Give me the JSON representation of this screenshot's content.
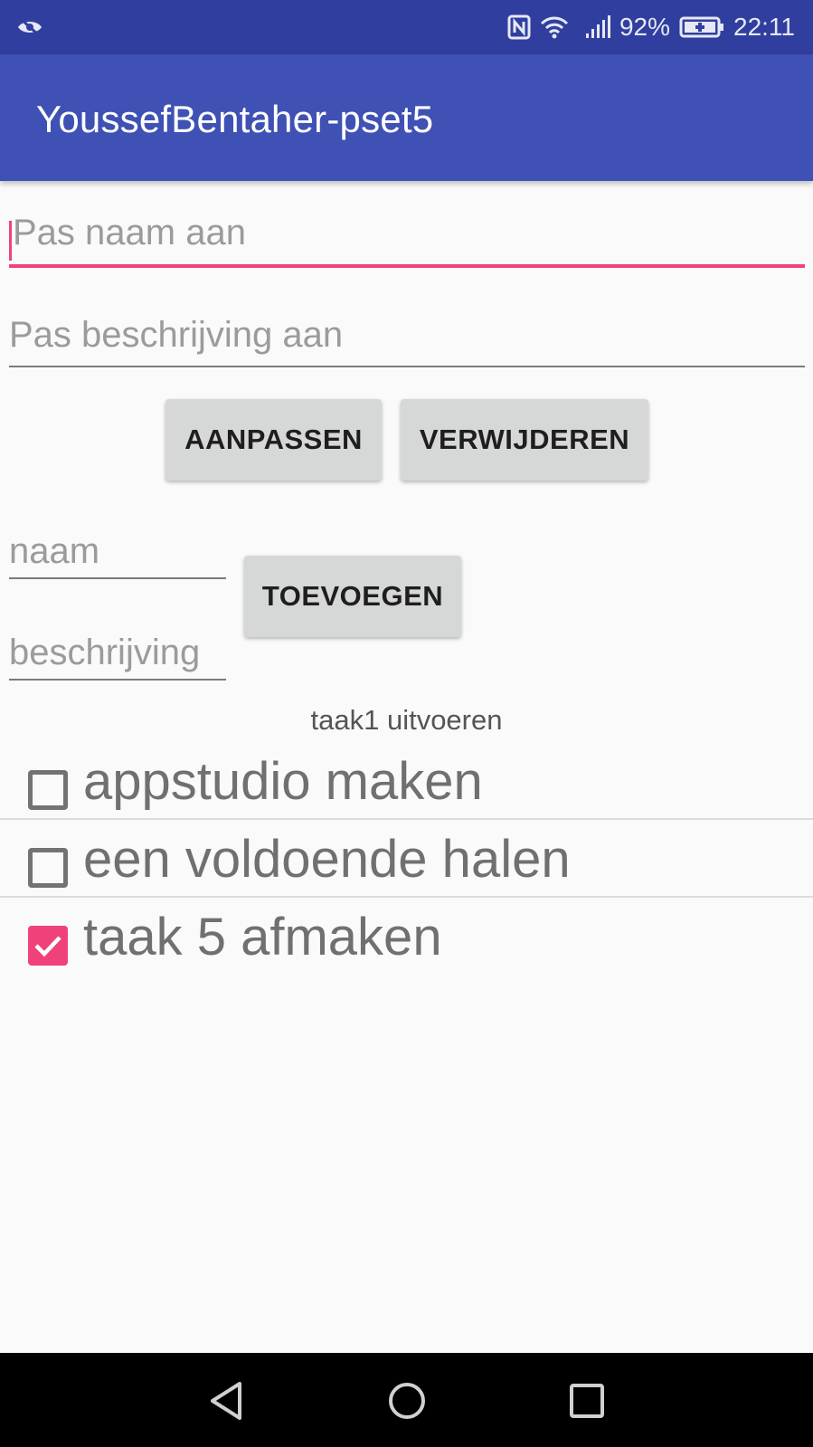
{
  "status_bar": {
    "battery_percent": "92%",
    "time": "22:11",
    "icons": [
      "eye-off-icon",
      "nfc-icon",
      "wifi-icon",
      "signal-icon",
      "battery-charging-icon"
    ]
  },
  "app_bar": {
    "title": "YoussefBentaher-pset5"
  },
  "edit_section": {
    "name_placeholder": "Pas naam aan",
    "description_placeholder": "Pas beschrijving aan",
    "update_label": "AANPASSEN",
    "delete_label": "VERWIJDEREN"
  },
  "add_section": {
    "name_placeholder": "naam",
    "description_placeholder": "beschrijving",
    "add_label": "TOEVOEGEN"
  },
  "task_caption": "taak1 uitvoeren",
  "tasks": [
    {
      "label": "appstudio maken",
      "checked": false
    },
    {
      "label": "een voldoende halen",
      "checked": false
    },
    {
      "label": "taak 5 afmaken",
      "checked": true
    }
  ],
  "nav_bar": {
    "icons": [
      "back-icon",
      "home-icon",
      "recents-icon"
    ]
  },
  "colors": {
    "status_bar": "#303f9f",
    "app_bar": "#3f51b5",
    "accent": "#f0427a"
  }
}
